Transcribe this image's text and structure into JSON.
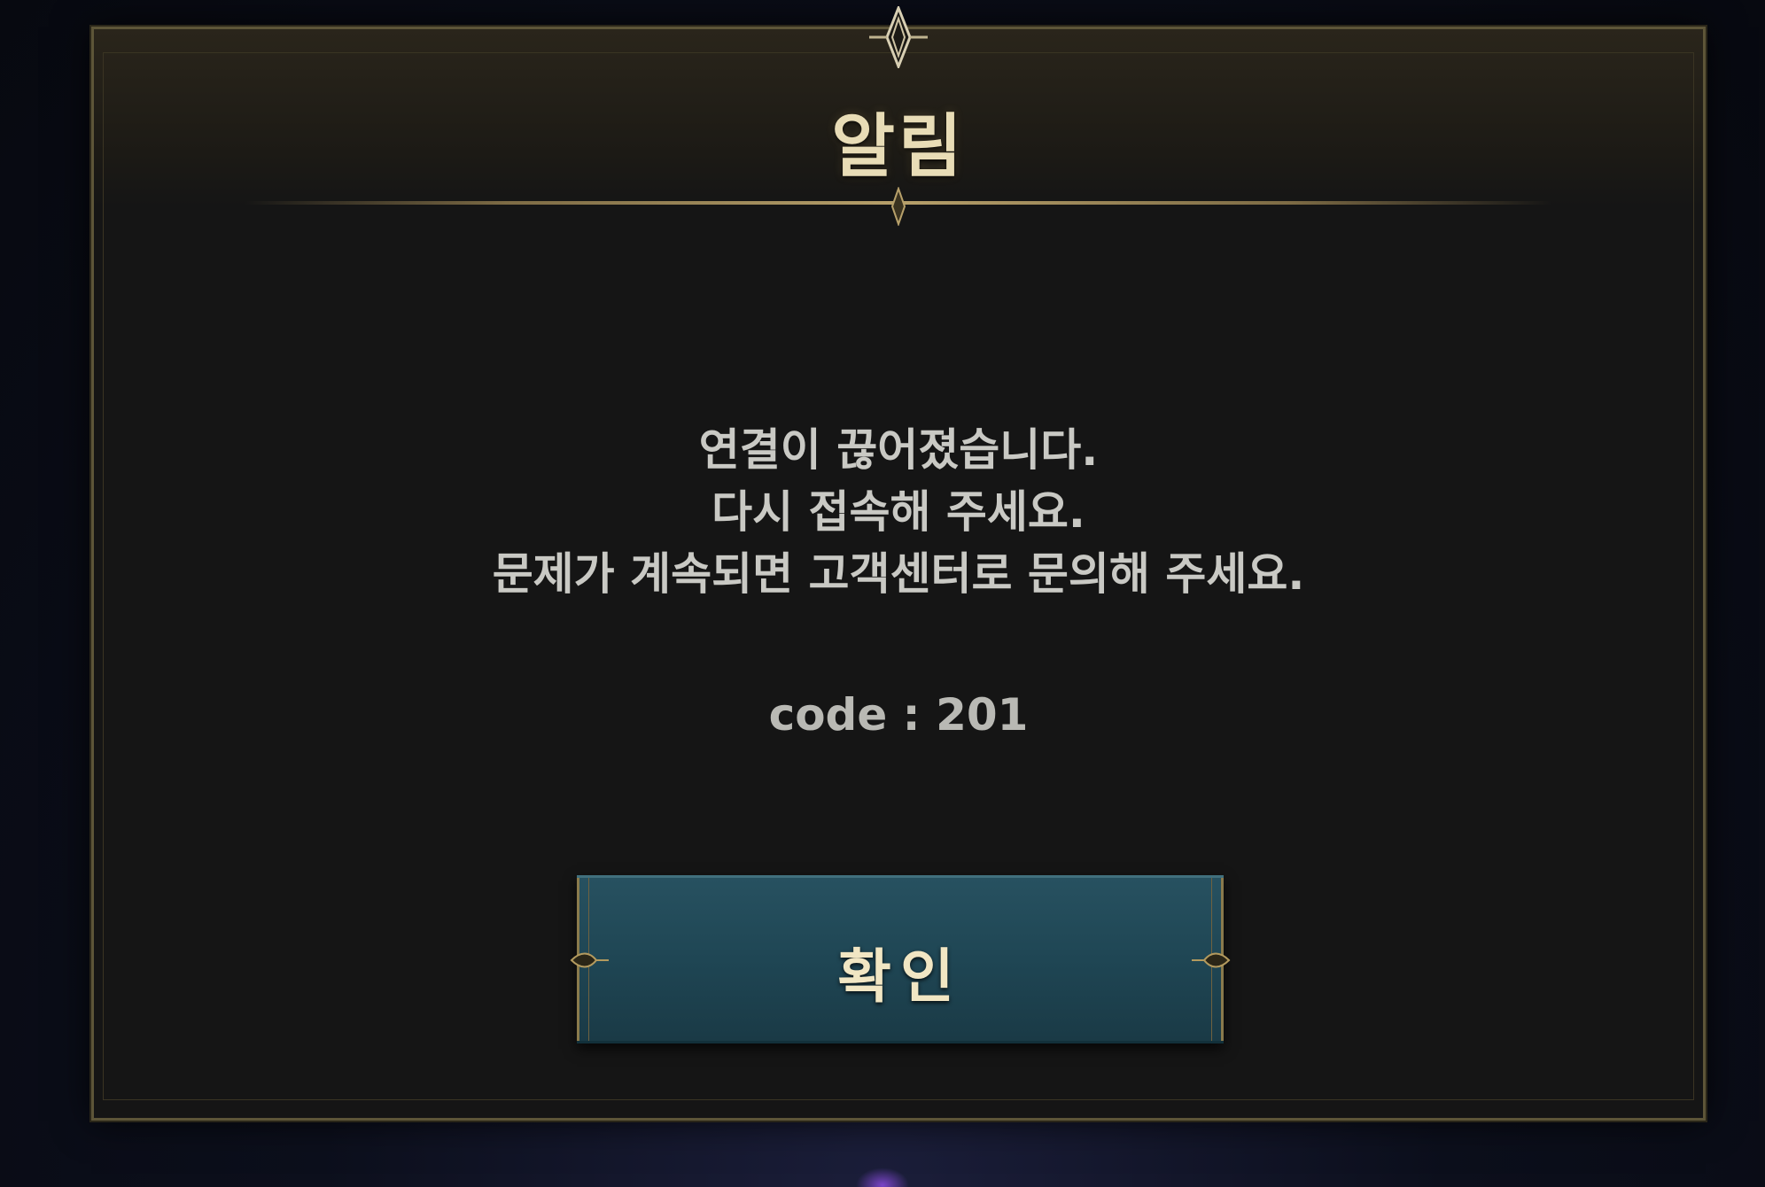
{
  "dialog": {
    "title": "알림",
    "message_lines": [
      "연결이 끊어졌습니다.",
      "다시 접속해 주세요.",
      "문제가 계속되면 고객센터로 문의해 주세요."
    ],
    "code_text": "code : 201",
    "confirm_label": "확인"
  },
  "colors": {
    "frame_gold": "#5d5538",
    "title_text": "#e8dcb6",
    "body_text": "#c9c9c4",
    "button_teal": "#1f4654",
    "panel_bg": "#151515"
  },
  "icons": {
    "top_ornament": "diamond-crest-icon",
    "divider_ornament": "diamond-pin-icon",
    "button_ornaments": "gold-filigree-icon"
  }
}
